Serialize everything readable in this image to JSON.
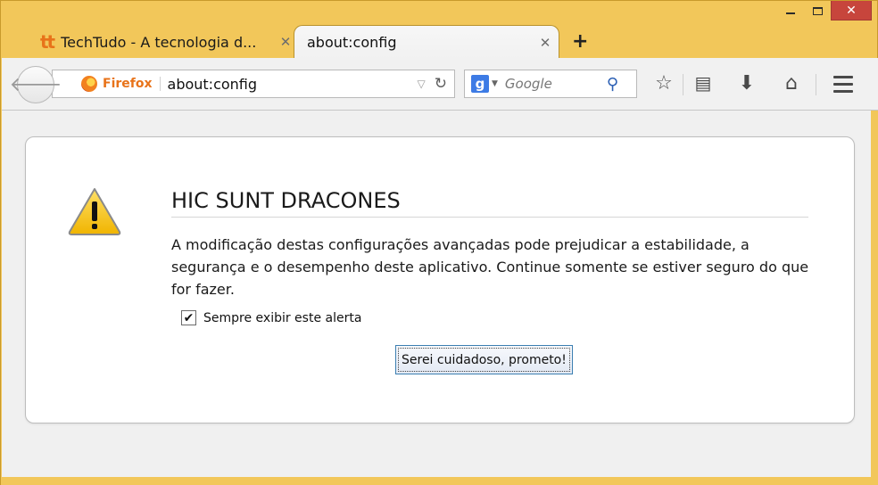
{
  "window": {
    "controls": {
      "minimize": "minimize",
      "maximize": "maximize",
      "close": "✕"
    }
  },
  "tabs": [
    {
      "title": "TechTudo - A tecnologia d...",
      "logo": "tt",
      "active": false
    },
    {
      "title": "about:config",
      "active": true
    }
  ],
  "new_tab_label": "+",
  "toolbar": {
    "identity_label": "Firefox",
    "url": "about:config",
    "search_placeholder": "Google",
    "search_engine_letter": "g"
  },
  "warning": {
    "title": "HIC SUNT DRACONES",
    "text": "A modificação destas configurações avançadas pode prejudicar a estabilidade, a segurança e o desempenho deste aplicativo. Continue somente se estiver seguro do que for fazer.",
    "checkbox_label": "Sempre exibir este alerta",
    "checkbox_checked": true,
    "button_label": "Serei cuidadoso, prometo!"
  },
  "colors": {
    "frame": "#f2c75a",
    "close_button": "#c7453c",
    "firefox_orange": "#e8731a",
    "focus_border": "#3c7fb1"
  },
  "icons": [
    "back-arrow-icon",
    "firefox-icon",
    "dropmarker-icon",
    "reload-icon",
    "google-icon",
    "search-icon",
    "bookmark-star-icon",
    "reading-list-icon",
    "download-icon",
    "home-icon",
    "menu-icon",
    "warning-icon"
  ]
}
